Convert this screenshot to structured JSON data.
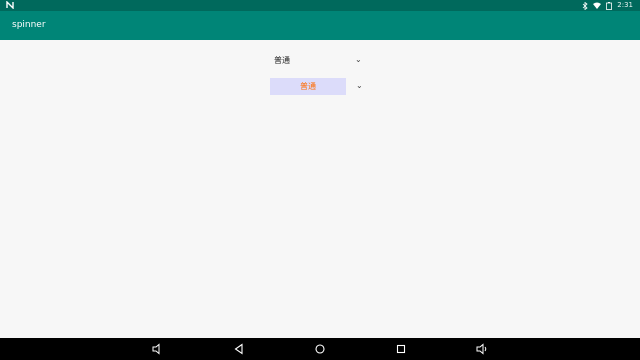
{
  "status_bar": {
    "notification_icon": "n-icon",
    "icons": [
      "bluetooth-icon",
      "wifi-icon",
      "battery-icon"
    ],
    "time": "2:31"
  },
  "toolbar": {
    "title": "spinner"
  },
  "spinners": [
    {
      "selected": "普通",
      "arrow": "⌄"
    },
    {
      "selected": "普通",
      "arrow": "⌄",
      "text_color": "#ff6a00",
      "background": "#dcdcfa"
    }
  ],
  "nav_bar": {
    "buttons": [
      "volume-down-icon",
      "back-icon",
      "home-icon",
      "recents-icon",
      "volume-up-icon"
    ]
  }
}
